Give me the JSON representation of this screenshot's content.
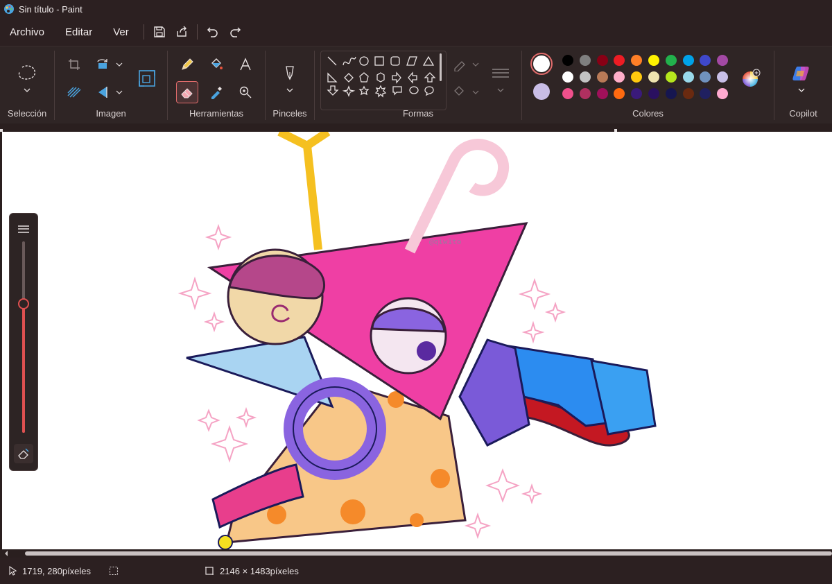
{
  "window": {
    "title": "Sin título - Paint"
  },
  "menu": {
    "file": "Archivo",
    "edit": "Editar",
    "view": "Ver"
  },
  "ribbon": {
    "selection_label": "Selección",
    "image_label": "Imagen",
    "tools_label": "Herramientas",
    "brushes_label": "Pinceles",
    "shapes_label": "Formas",
    "colors_label": "Colores",
    "copilot_label": "Copilot"
  },
  "colors": {
    "primary": "#ffffff",
    "secondary": "#c9bde6",
    "palette_row1": [
      "#000000",
      "#7f7f7f",
      "#880015",
      "#ed1c24",
      "#ff7f27",
      "#fff200",
      "#22b14c",
      "#00a2e8",
      "#3f48cc",
      "#a349a4"
    ],
    "palette_row2": [
      "#ffffff",
      "#c3c3c3",
      "#b97a57",
      "#ffaec9",
      "#ffc90e",
      "#efe4b0",
      "#b5e61d",
      "#99d9ea",
      "#7092be",
      "#c8bfe7"
    ],
    "palette_row3": [
      "#f0508c",
      "#b03060",
      "#a0105a",
      "#ff6a10",
      "#3a1a7a",
      "#2a1060",
      "#161650",
      "#6a2a10",
      "#202060",
      "#ffaad0"
    ]
  },
  "canvas": {
    "watermark": "@qiw1to"
  },
  "status": {
    "cursor_pos": "1719, 280píxeles",
    "canvas_size": "2146 × 1483píxeles"
  },
  "icons": {
    "app": "paint-palette-icon",
    "save": "save-icon",
    "share": "share-icon",
    "undo": "undo-icon",
    "redo": "redo-icon"
  }
}
